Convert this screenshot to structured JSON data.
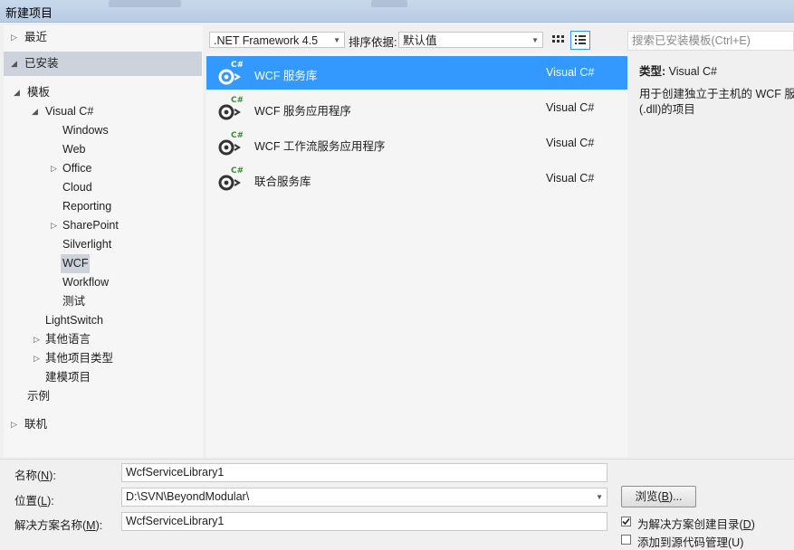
{
  "window": {
    "title": "新建项目"
  },
  "tree": {
    "recent": "最近",
    "installed": "已安装",
    "templates": "模板",
    "visual_csharp": "Visual C#",
    "windows": "Windows",
    "web": "Web",
    "office": "Office",
    "cloud": "Cloud",
    "reporting": "Reporting",
    "sharepoint": "SharePoint",
    "silverlight": "Silverlight",
    "wcf": "WCF",
    "workflow": "Workflow",
    "test": "测试",
    "lightswitch": "LightSwitch",
    "other_languages": "其他语言",
    "other_project_types": "其他项目类型",
    "modeling_projects": "建模项目",
    "samples": "示例",
    "online": "联机"
  },
  "toolbar": {
    "framework": ".NET Framework 4.5",
    "sort_label": "排序依据:",
    "sort_value": "默认值",
    "search_placeholder": "搜索已安装模板(Ctrl+E)"
  },
  "templates": [
    {
      "name": "WCF 服务库",
      "lang": "Visual C#",
      "selected": true
    },
    {
      "name": "WCF 服务应用程序",
      "lang": "Visual C#",
      "selected": false
    },
    {
      "name": "WCF 工作流服务应用程序",
      "lang": "Visual C#",
      "selected": false
    },
    {
      "name": "联合服务库",
      "lang": "Visual C#",
      "selected": false
    }
  ],
  "details": {
    "type_label": "类型:",
    "type_value": "Visual C#",
    "description_line1": "用于创建独立于主机的 WCF 服务",
    "description_line2": "(.dll)的项目"
  },
  "form": {
    "name_label": "名称(",
    "name_key": "N",
    "name_label_end": "):",
    "name_value": "WcfServiceLibrary1",
    "location_label": "位置(",
    "location_key": "L",
    "location_label_end": "):",
    "location_value": "D:\\SVN\\BeyondModular\\",
    "solution_label": "解决方案名称(",
    "solution_key": "M",
    "solution_label_end": "):",
    "solution_value": "WcfServiceLibrary1",
    "browse_label": "浏览(",
    "browse_key": "B",
    "browse_label_end": ")...",
    "create_dir_label": "为解决方案创建目录(",
    "create_dir_key": "D",
    "create_dir_label_end": ")",
    "create_dir_checked": true,
    "source_control_label": "添加到源代码管理(U)",
    "source_control_checked": false
  },
  "colors": {
    "selection": "#3399ff",
    "tree_selection": "#ccd3dc",
    "icon": "#333333",
    "csharp_badge": "#3c8c3c"
  }
}
